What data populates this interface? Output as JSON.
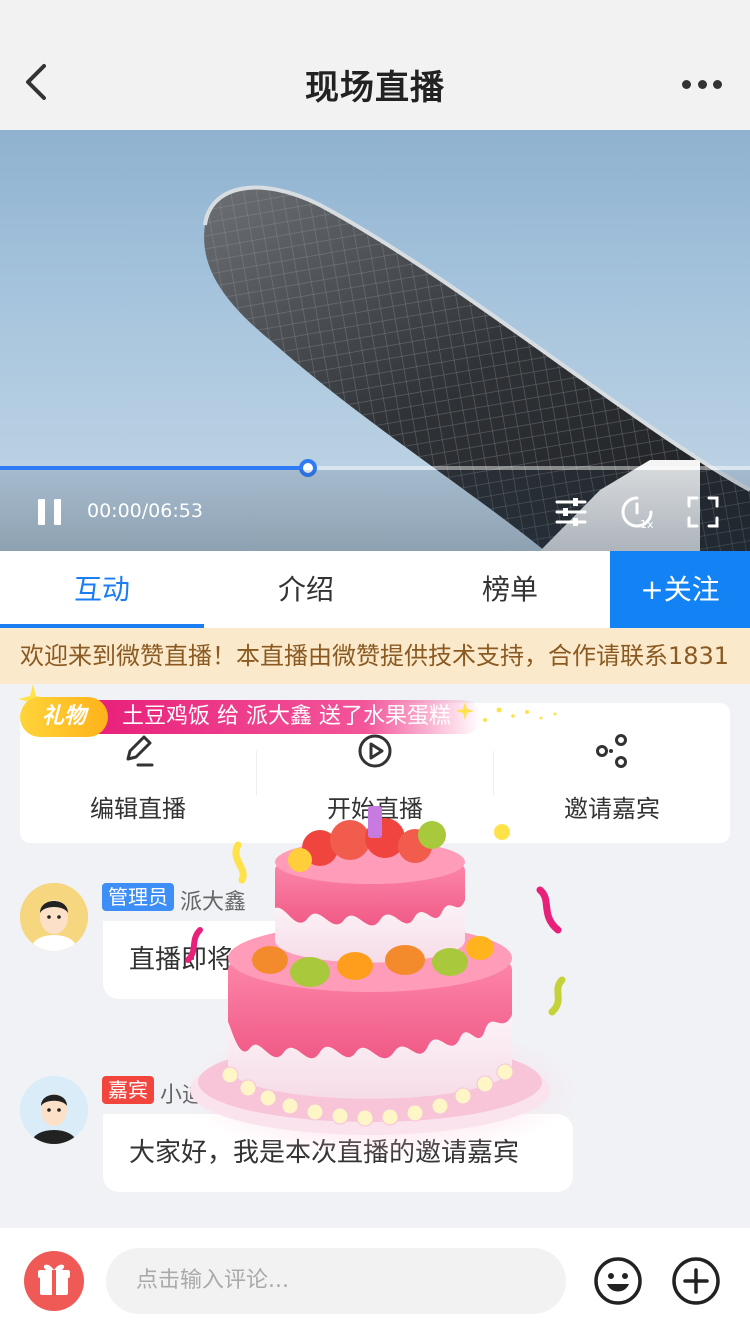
{
  "nav": {
    "title": "现场直播"
  },
  "player": {
    "time": "00:00/06:53",
    "progress": 0.41,
    "speed": "1x"
  },
  "tabs": [
    {
      "label": "互动"
    },
    {
      "label": "介绍"
    },
    {
      "label": "榜单"
    }
  ],
  "follow_label": "+关注",
  "notice": "欢迎来到微赞直播！本直播由微赞提供技术支持，合作请联系1831",
  "gift": {
    "tag": "礼物",
    "message": "土豆鸡饭 给 派大鑫 送了水果蛋糕"
  },
  "actions": [
    {
      "label": "编辑直播",
      "icon": "edit-icon"
    },
    {
      "label": "开始直播",
      "icon": "play-circle-icon"
    },
    {
      "label": "邀请嘉宾",
      "icon": "share-nodes-icon"
    }
  ],
  "messages": [
    {
      "role": "管理员",
      "role_color": "#3d8ef7",
      "name": "派大鑫",
      "text": "直播即将开始"
    },
    {
      "role": "嘉宾",
      "role_color": "#f2453d",
      "name": "小迪",
      "text": "大家好，我是本次直播的邀请嘉宾"
    }
  ],
  "input": {
    "placeholder": "点击输入评论..."
  },
  "colors": {
    "accent": "#1282f5",
    "notice_bg": "#fbe9cb",
    "gift_pink": "#e8207a"
  }
}
